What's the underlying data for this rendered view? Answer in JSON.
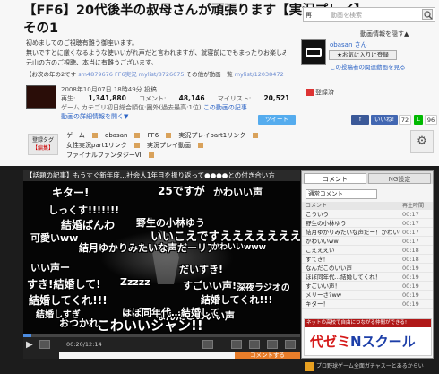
{
  "header": {
    "title": "【FF6】20代後半の叔母さんが頑張ります【実況プレイ】その1",
    "search_select": "再",
    "search_placeholder": "動画を検索",
    "expand_link": "動画情報を隠す▲"
  },
  "description": {
    "lines": [
      "初めましてのご視聴有難う御座います。",
      "無いですとに厳くなるような使いいがれ声だと言われますが、就寝前にでもまったりお楽しみ下さい。",
      "元山の方のご視聴、本当に有難うございます。"
    ],
    "refs_label": "【お次の年の2です",
    "refs": [
      "sm4879676",
      "FF6実況",
      "mylist/8726675",
      "その他が動画一覧",
      "mylist/12038472"
    ]
  },
  "owner": {
    "name": "obasan さん",
    "follow_button": "★お気に入りに登録",
    "link": "この投稿者の関連動画を見る"
  },
  "meta": {
    "date": "2008年10月07日 18時49分 投稿",
    "views_label": "再生:",
    "views": "1,341,880",
    "comments_label": "コメント:",
    "comments": "48,146",
    "mylist_label": "マイリスト:",
    "mylist": "20,521",
    "category": "ゲーム カテゴリ初日総合順位:圏外(過去最高:1位)",
    "article_link": "この動画の記事",
    "detail_link": "動画の詳細情報を開く▼",
    "bookmark": "登録済"
  },
  "share": {
    "tweet": "ツイート",
    "like": "いいね!",
    "like_count": "72",
    "count": "96"
  },
  "tags": {
    "box_label": "登録タグ",
    "box_edit": "【編集】",
    "items": [
      "ゲーム",
      "obasan",
      "FF6",
      "実況プレイpart1リンク",
      "女性実況part1リンク",
      "実況プレイ動画",
      "ファイナルファンタジーVI"
    ]
  },
  "player": {
    "ticker": "【話題の記事】もうすぐ新年度…社会人1年目を振り返って●●●●との付き合い方",
    "time": "00:20/12:14",
    "progress": 0.03,
    "comment_send": "コメントする",
    "overlay_comments": [
      "25ですが",
      "キター!",
      "かわいい声",
      "しっくす!!!!!!!",
      "結婚ばんわ",
      "野生の小林ゆう",
      "いいこえですえええええええええええええ",
      "可愛いww",
      "結月ゆかりみたいな声だーリア",
      "かわいいwww",
      "いい声ー",
      "だいすき!",
      "すき!結婚して!",
      "Zzzzz",
      "すごいい声!!",
      "深夜ラジオの",
      "結婚してくれ!!!",
      "結婚してくれ!!!",
      "なんだこのいい声",
      "ほぼ同年代…結婚して",
      "おつかれ",
      "こわいいシャン!!",
      "結婚しすぎ"
    ]
  },
  "comment_panel": {
    "tab_comments": "コメント",
    "tab_ng": "NG設定",
    "select": "通常コメント",
    "col_comment": "コメント",
    "col_time": "再生時間",
    "rows": [
      {
        "c": "こういう",
        "t": "00:17"
      },
      {
        "c": "野生の小林ゆう",
        "t": "00:17"
      },
      {
        "c": "結月ゆかりみたいな声だー！かわいいー！",
        "t": "00:17"
      },
      {
        "c": "かわいいww",
        "t": "00:17"
      },
      {
        "c": "こえええい",
        "t": "00:18"
      },
      {
        "c": "すてき！",
        "t": "00:18"
      },
      {
        "c": "なんだこのいい声",
        "t": "00:19"
      },
      {
        "c": "ほぼ同年代…結婚してくれ！",
        "t": "00:19"
      },
      {
        "c": "すごいい声！",
        "t": "00:19"
      },
      {
        "c": "メリーさ?ww",
        "t": "00:19"
      },
      {
        "c": "キター！",
        "t": "00:19"
      }
    ]
  },
  "ad": {
    "headline": "ネットの高校で自由につながる仲間ができる!",
    "brand_a": "代ゼミ",
    "brand_b": "Nスクール"
  },
  "footer": {
    "text": "プロ野球ゲーム全面ガチャスーとあるからい"
  }
}
